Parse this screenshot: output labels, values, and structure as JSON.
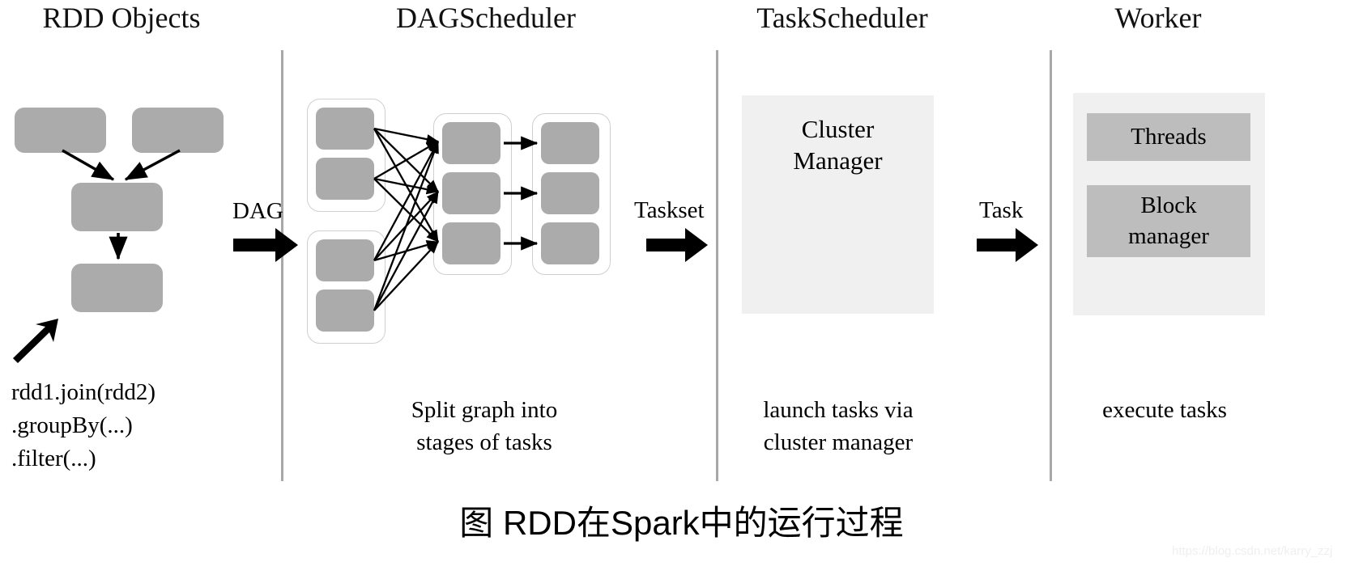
{
  "figure": {
    "caption": "图 RDD在Spark中的运行过程",
    "watermark": "https://blog.csdn.net/karry_zzj",
    "box_color": "#ababab",
    "panel_color": "#f0f0f0",
    "panel_inner_color": "#bdbdbd",
    "divider_color": "#a8a8a8",
    "arrow_color": "#000000"
  },
  "columns": [
    {
      "title": "RDD Objects",
      "caption": ""
    },
    {
      "title": "DAGScheduler",
      "caption": "Split graph into\nstages of tasks"
    },
    {
      "title": "TaskScheduler",
      "caption": "launch tasks via\ncluster manager"
    },
    {
      "title": "Worker",
      "caption": "execute tasks"
    }
  ],
  "rdd_objects": {
    "code": "rdd1.join(rdd2)\n      .groupBy(...)\n        .filter(...)",
    "nodes": [
      {
        "id": "rdd1",
        "label": ""
      },
      {
        "id": "rdd2",
        "label": ""
      },
      {
        "id": "joined",
        "label": ""
      },
      {
        "id": "filtered",
        "label": ""
      }
    ],
    "edges": [
      {
        "from": "rdd1",
        "to": "joined"
      },
      {
        "from": "rdd2",
        "to": "joined"
      },
      {
        "from": "joined",
        "to": "filtered"
      }
    ],
    "pointer_icon": "arrow-up-right-icon"
  },
  "dag_scheduler": {
    "stages": [
      {
        "name": "stage-1",
        "task_count": 2
      },
      {
        "name": "stage-2",
        "task_count": 2
      },
      {
        "name": "stage-3",
        "task_count": 3
      },
      {
        "name": "stage-4",
        "task_count": 3
      }
    ]
  },
  "task_scheduler": {
    "cluster_manager_label": "Cluster\nManager"
  },
  "worker": {
    "blocks": [
      {
        "label": "Threads"
      },
      {
        "label": "Block\nmanager"
      }
    ]
  },
  "transitions": [
    {
      "label": "DAG",
      "icon": "arrow-right-icon"
    },
    {
      "label": "Taskset",
      "icon": "arrow-right-icon"
    },
    {
      "label": "Task",
      "icon": "arrow-right-icon"
    }
  ]
}
